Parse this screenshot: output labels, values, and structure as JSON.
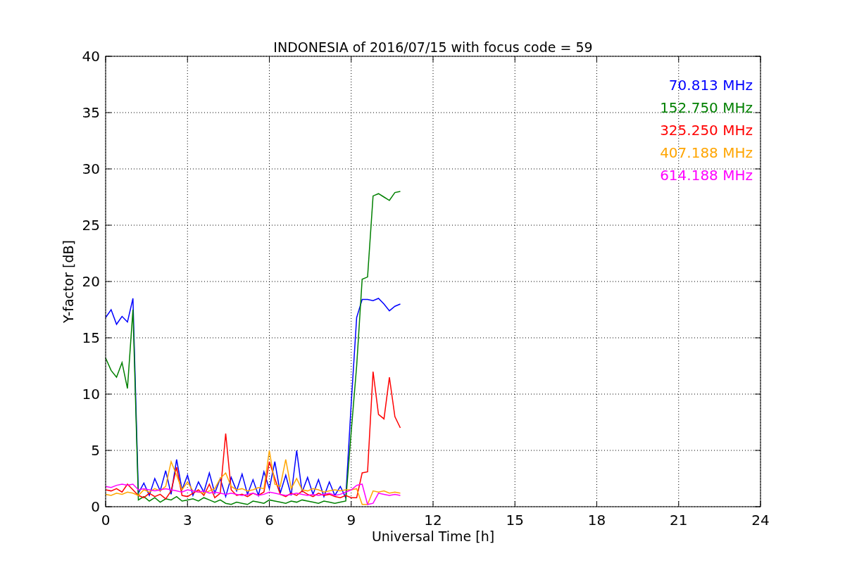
{
  "figure": {
    "chart_data": {
      "type": "line",
      "title": "INDONESIA of 2016/07/15 with focus code = 59",
      "xlabel": "Universal Time [h]",
      "ylabel": "Y-factor [dB]",
      "xlim": [
        0,
        24
      ],
      "ylim": [
        0,
        40
      ],
      "xticks": [
        0,
        3,
        6,
        9,
        12,
        15,
        18,
        21,
        24
      ],
      "yticks": [
        0,
        5,
        10,
        15,
        20,
        25,
        30,
        35,
        40
      ],
      "grid": true,
      "x": [
        0,
        0.2,
        0.4,
        0.6,
        0.8,
        1.0,
        1.2,
        1.4,
        1.6,
        1.8,
        2.0,
        2.2,
        2.4,
        2.6,
        2.8,
        3.0,
        3.2,
        3.4,
        3.6,
        3.8,
        4.0,
        4.2,
        4.4,
        4.6,
        4.8,
        5.0,
        5.2,
        5.4,
        5.6,
        5.8,
        6.0,
        6.2,
        6.4,
        6.6,
        6.8,
        7.0,
        7.2,
        7.4,
        7.6,
        7.8,
        8.0,
        8.2,
        8.4,
        8.6,
        8.8,
        9.0,
        9.2,
        9.4,
        9.6,
        9.8,
        10.0,
        10.2,
        10.4,
        10.6,
        10.8
      ],
      "series": [
        {
          "name": "70.813 MHz",
          "color": "#0000ff",
          "values": [
            16.8,
            17.5,
            16.2,
            16.9,
            16.4,
            18.5,
            1.2,
            2.1,
            1.0,
            2.5,
            1.4,
            3.2,
            1.1,
            4.2,
            1.5,
            2.8,
            1.0,
            2.2,
            1.3,
            3.0,
            1.2,
            2.5,
            0.9,
            2.6,
            1.4,
            2.9,
            1.1,
            2.4,
            1.0,
            3.1,
            1.6,
            4.0,
            1.2,
            2.8,
            1.0,
            5.0,
            1.3,
            2.6,
            1.1,
            2.4,
            0.9,
            2.2,
            1.0,
            1.8,
            0.8,
            9.2,
            16.8,
            18.4,
            18.4,
            18.3,
            18.5,
            18.0,
            17.4,
            17.8,
            18.0
          ]
        },
        {
          "name": "152.750 MHz",
          "color": "#008000",
          "values": [
            13.2,
            12.1,
            11.5,
            12.8,
            10.5,
            17.5,
            0.6,
            0.9,
            0.5,
            0.8,
            0.4,
            0.7,
            0.6,
            0.9,
            0.5,
            0.6,
            0.7,
            0.5,
            0.8,
            0.6,
            0.4,
            0.6,
            0.3,
            0.2,
            0.4,
            0.3,
            0.2,
            0.5,
            0.4,
            0.3,
            0.6,
            0.5,
            0.4,
            0.3,
            0.5,
            0.4,
            0.6,
            0.5,
            0.4,
            0.3,
            0.5,
            0.4,
            0.3,
            0.4,
            0.5,
            6.7,
            12.5,
            20.2,
            20.4,
            27.6,
            27.8,
            27.5,
            27.2,
            27.9,
            28.0
          ]
        },
        {
          "name": "325.250 MHz",
          "color": "#ff0000",
          "values": [
            1.5,
            1.4,
            1.6,
            1.3,
            2.0,
            1.5,
            1.0,
            0.8,
            1.2,
            0.9,
            1.1,
            0.7,
            1.4,
            3.5,
            1.0,
            0.9,
            1.2,
            1.5,
            1.0,
            2.0,
            0.8,
            1.2,
            6.5,
            1.5,
            1.0,
            1.1,
            0.9,
            1.2,
            1.0,
            1.3,
            4.0,
            2.5,
            1.1,
            0.9,
            1.2,
            1.0,
            1.4,
            1.1,
            0.9,
            1.2,
            1.0,
            1.1,
            0.9,
            0.8,
            1.0,
            0.8,
            0.8,
            3.0,
            3.1,
            12.0,
            8.2,
            7.8,
            11.5,
            8.0,
            7.0
          ]
        },
        {
          "name": "407.188 MHz",
          "color": "#ffa500",
          "values": [
            1.1,
            1.0,
            1.2,
            1.1,
            1.3,
            1.2,
            1.0,
            1.5,
            1.3,
            1.6,
            1.4,
            1.8,
            4.0,
            2.8,
            1.5,
            2.2,
            1.4,
            1.3,
            1.2,
            1.4,
            1.6,
            2.5,
            3.0,
            1.8,
            1.5,
            1.6,
            1.4,
            1.5,
            1.7,
            1.6,
            5.0,
            2.0,
            1.8,
            4.2,
            1.6,
            2.5,
            1.5,
            1.4,
            1.6,
            1.5,
            1.3,
            1.4,
            1.5,
            1.4,
            1.5,
            1.5,
            1.6,
            0.2,
            0.2,
            1.4,
            1.3,
            1.4,
            1.2,
            1.3,
            1.2
          ]
        },
        {
          "name": "614.188 MHz",
          "color": "#ff00ff",
          "values": [
            1.8,
            1.7,
            1.9,
            2.0,
            1.9,
            2.0,
            1.5,
            1.6,
            1.5,
            1.4,
            1.5,
            1.6,
            1.5,
            1.4,
            1.3,
            1.5,
            1.4,
            1.3,
            1.4,
            1.2,
            1.3,
            1.2,
            1.1,
            1.2,
            1.1,
            1.0,
            1.1,
            1.2,
            1.0,
            1.1,
            1.3,
            1.2,
            1.1,
            1.0,
            1.1,
            1.2,
            1.1,
            1.0,
            1.1,
            1.0,
            1.1,
            1.2,
            1.0,
            1.1,
            1.3,
            1.5,
            1.9,
            2.0,
            0.2,
            0.3,
            1.2,
            1.1,
            1.0,
            1.1,
            1.0
          ]
        }
      ]
    }
  }
}
